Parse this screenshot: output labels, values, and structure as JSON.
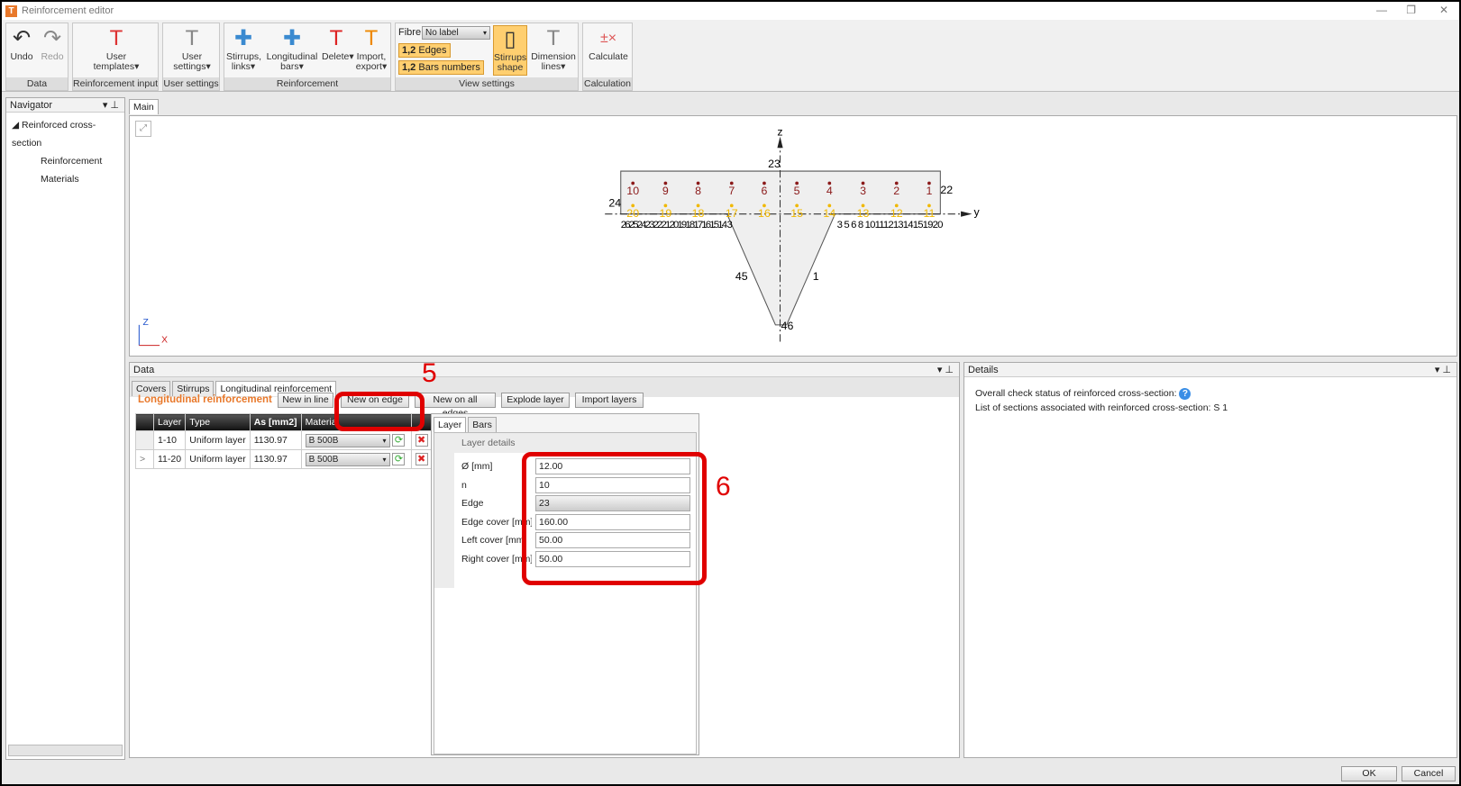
{
  "window": {
    "title": "Reinforcement editor",
    "min": "—",
    "max": "❐",
    "close": "✕"
  },
  "ribbon": {
    "groups": [
      "Data",
      "Reinforcement input",
      "User settings",
      "Reinforcement",
      "View settings",
      "Calculation"
    ],
    "undo": "Undo",
    "redo": "Redo",
    "user_templates": "User templates▾",
    "user_settings": "User settings▾",
    "stirrups": "Stirrups, links▾",
    "longitudinal": "Longitudinal bars▾",
    "delete": "Delete▾",
    "import": "Import, export▾",
    "fibre_label": "Fibre",
    "fibre_value": "No label",
    "edges": "Edges",
    "bars_numbers": "Bars numbers",
    "badge": "1,2",
    "stirrups_shape": "Stirrups shape",
    "dimension_lines": "Dimension lines▾",
    "calculate": "Calculate"
  },
  "navigator": {
    "title": "Navigator",
    "root": "Reinforced cross-section",
    "items": [
      "Reinforcement",
      "Materials"
    ]
  },
  "main": {
    "tab": "Main",
    "axis_z": "z",
    "axis_y": "y",
    "corner_z": "Z",
    "corner_x": "X",
    "top_bars": [
      "1",
      "2",
      "3",
      "4",
      "5",
      "6",
      "7",
      "8",
      "9",
      "10"
    ],
    "bottom_bars": [
      "11",
      "12",
      "13",
      "14",
      "15",
      "16",
      "17",
      "18",
      "19",
      "20"
    ],
    "edges": {
      "e23": "23",
      "e22": "22",
      "e24": "24",
      "e45": "45",
      "e1": "1",
      "e46": "46"
    },
    "left_clutter": "26252423222120191817161514 3",
    "right_clutter": "3 5 6 8 1011121314151920"
  },
  "data_panel": {
    "title": "Data",
    "tabs": [
      "Covers",
      "Stirrups",
      "Longitudinal reinforcement"
    ],
    "section_title": "Longitudinal reinforcement",
    "buttons": [
      "New in line",
      "New on edge",
      "New on all edges",
      "Explode layer",
      "Import layers"
    ],
    "columns": [
      "Layer",
      "Type",
      "As [mm2]",
      "Material"
    ],
    "rows": [
      {
        "layer": "1-10",
        "type": "Uniform layer",
        "as": "1130.97",
        "material": "B 500B"
      },
      {
        "layer": "11-20",
        "type": "Uniform layer",
        "as": "1130.97",
        "material": "B 500B",
        "marker": ">"
      }
    ],
    "detail_tabs": [
      "Layer",
      "Bars"
    ],
    "layer_details": "Layer details",
    "fields": [
      {
        "label": "Ø [mm]",
        "value": "12.00"
      },
      {
        "label": "n",
        "value": "10"
      },
      {
        "label": "Edge",
        "value": "23"
      },
      {
        "label": "Edge cover [mm]",
        "value": "160.00"
      },
      {
        "label": "Left cover [mm]",
        "value": "50.00"
      },
      {
        "label": "Right cover [mm]",
        "value": "50.00"
      }
    ]
  },
  "details": {
    "title": "Details",
    "line1": "Overall check status of reinforced cross-section:",
    "line2": "List of sections associated with reinforced cross-section: S 1"
  },
  "annotations": {
    "a5": "5",
    "a6": "6"
  },
  "footer": {
    "ok": "OK",
    "cancel": "Cancel"
  },
  "colors": {
    "accent": "#e8782a",
    "highlight": "#ffcf70",
    "annotation": "#e00000",
    "top_bar": "#8b1a1a",
    "bottom_bar": "#f0b800"
  }
}
